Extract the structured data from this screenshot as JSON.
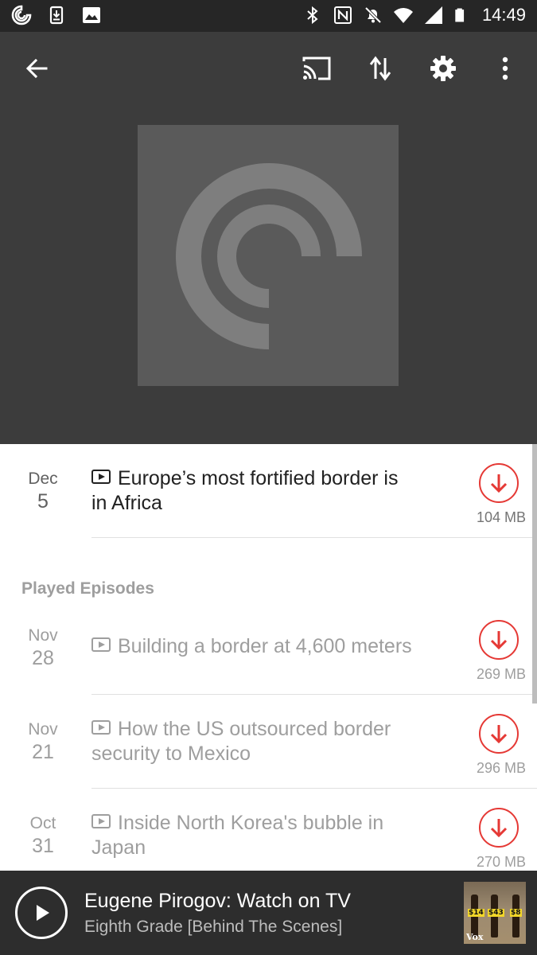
{
  "status_bar": {
    "time": "14:49",
    "left_icons": [
      "pocketcasts-notification-icon",
      "download-notification-icon",
      "image-notification-icon"
    ],
    "right_icons": [
      "bluetooth-icon",
      "nfc-icon",
      "mute-icon",
      "wifi-icon",
      "signal-icon",
      "battery-icon"
    ]
  },
  "toolbar": {
    "back_icon": "arrow-back-icon",
    "cast_icon": "cast-icon",
    "sort_icon": "sort-icon",
    "settings_icon": "gear-icon",
    "overflow_icon": "more-vert-icon"
  },
  "colors": {
    "header_bg": "#3c3c3c",
    "artwork_bg": "#5a5a5a",
    "accent_download": "#e53935",
    "player_bg": "#2d2d2d"
  },
  "episodes_unplayed": [
    {
      "month": "Dec",
      "day": "5",
      "title": "Europe’s most fortified border is in Africa",
      "size": "104 MB"
    }
  ],
  "played_section": {
    "title": "Played Episodes"
  },
  "episodes_played": [
    {
      "month": "Nov",
      "day": "28",
      "title": "Building a border at 4,600 meters",
      "size": "269 MB"
    },
    {
      "month": "Nov",
      "day": "21",
      "title": "How the US outsourced border security to Mexico",
      "size": "296 MB"
    },
    {
      "month": "Oct",
      "day": "31",
      "title": "Inside North Korea's bubble in Japan",
      "size": "270 MB"
    }
  ],
  "player": {
    "title": "Eugene Pirogov: Watch on TV",
    "subtitle": "Eighth Grade [Behind The Scenes]",
    "thumbnail_prices": [
      "$14",
      "$43",
      "$8"
    ],
    "thumbnail_logo": "Vox"
  }
}
